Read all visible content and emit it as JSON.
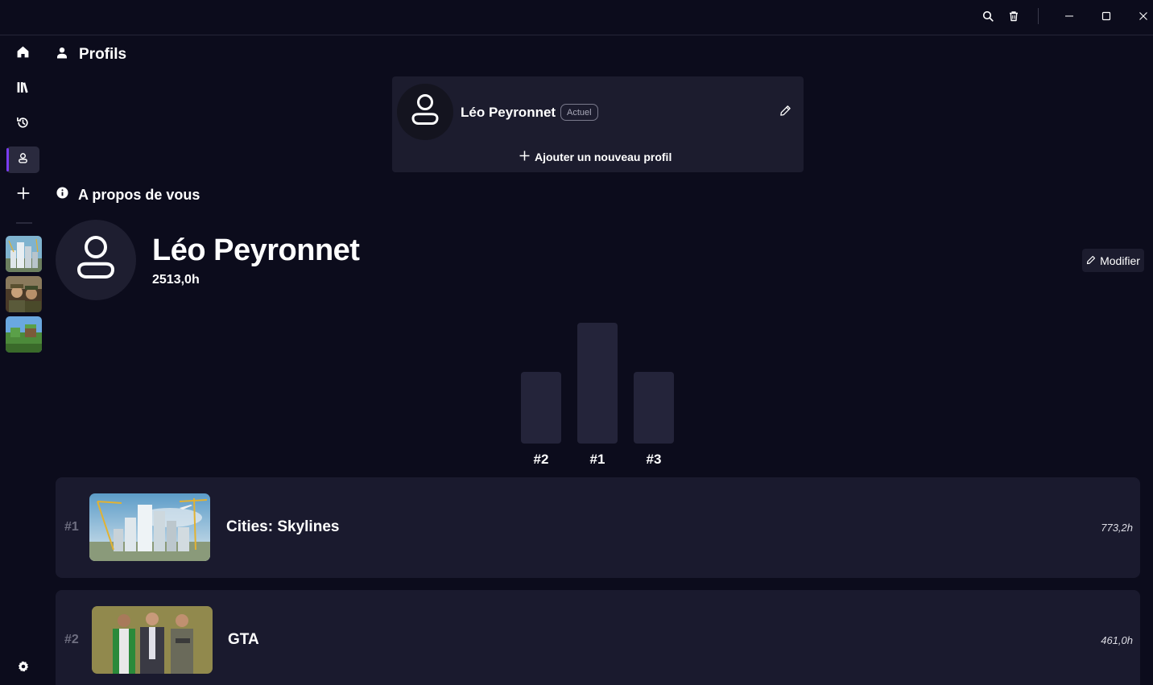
{
  "header": {
    "title": "Profils"
  },
  "profiles": {
    "current_name": "Léo Peyronnet",
    "current_badge": "Actuel",
    "add_label": "Ajouter un nouveau profil"
  },
  "about": {
    "title": "A propos de vous",
    "name": "Léo Peyronnet",
    "total_hours": "2513,0h",
    "modify_label": "Modifier"
  },
  "podium": {
    "labels": [
      "#2",
      "#1",
      "#3"
    ]
  },
  "ranking": [
    {
      "rank": "#1",
      "name": "Cities: Skylines",
      "hours": "773,2h"
    },
    {
      "rank": "#2",
      "name": "GTA",
      "hours": "461,0h"
    }
  ],
  "sidebar": {
    "items": [
      "home-icon",
      "library-icon",
      "history-icon",
      "profile-icon",
      "add-icon"
    ],
    "recent_games": [
      "Cities: Skylines",
      "Historical strategy game",
      "Voxel sandbox game"
    ]
  },
  "colors": {
    "background": "#0c0c1c",
    "card": "#1c1c2e",
    "accent": "#7a3cf0"
  }
}
